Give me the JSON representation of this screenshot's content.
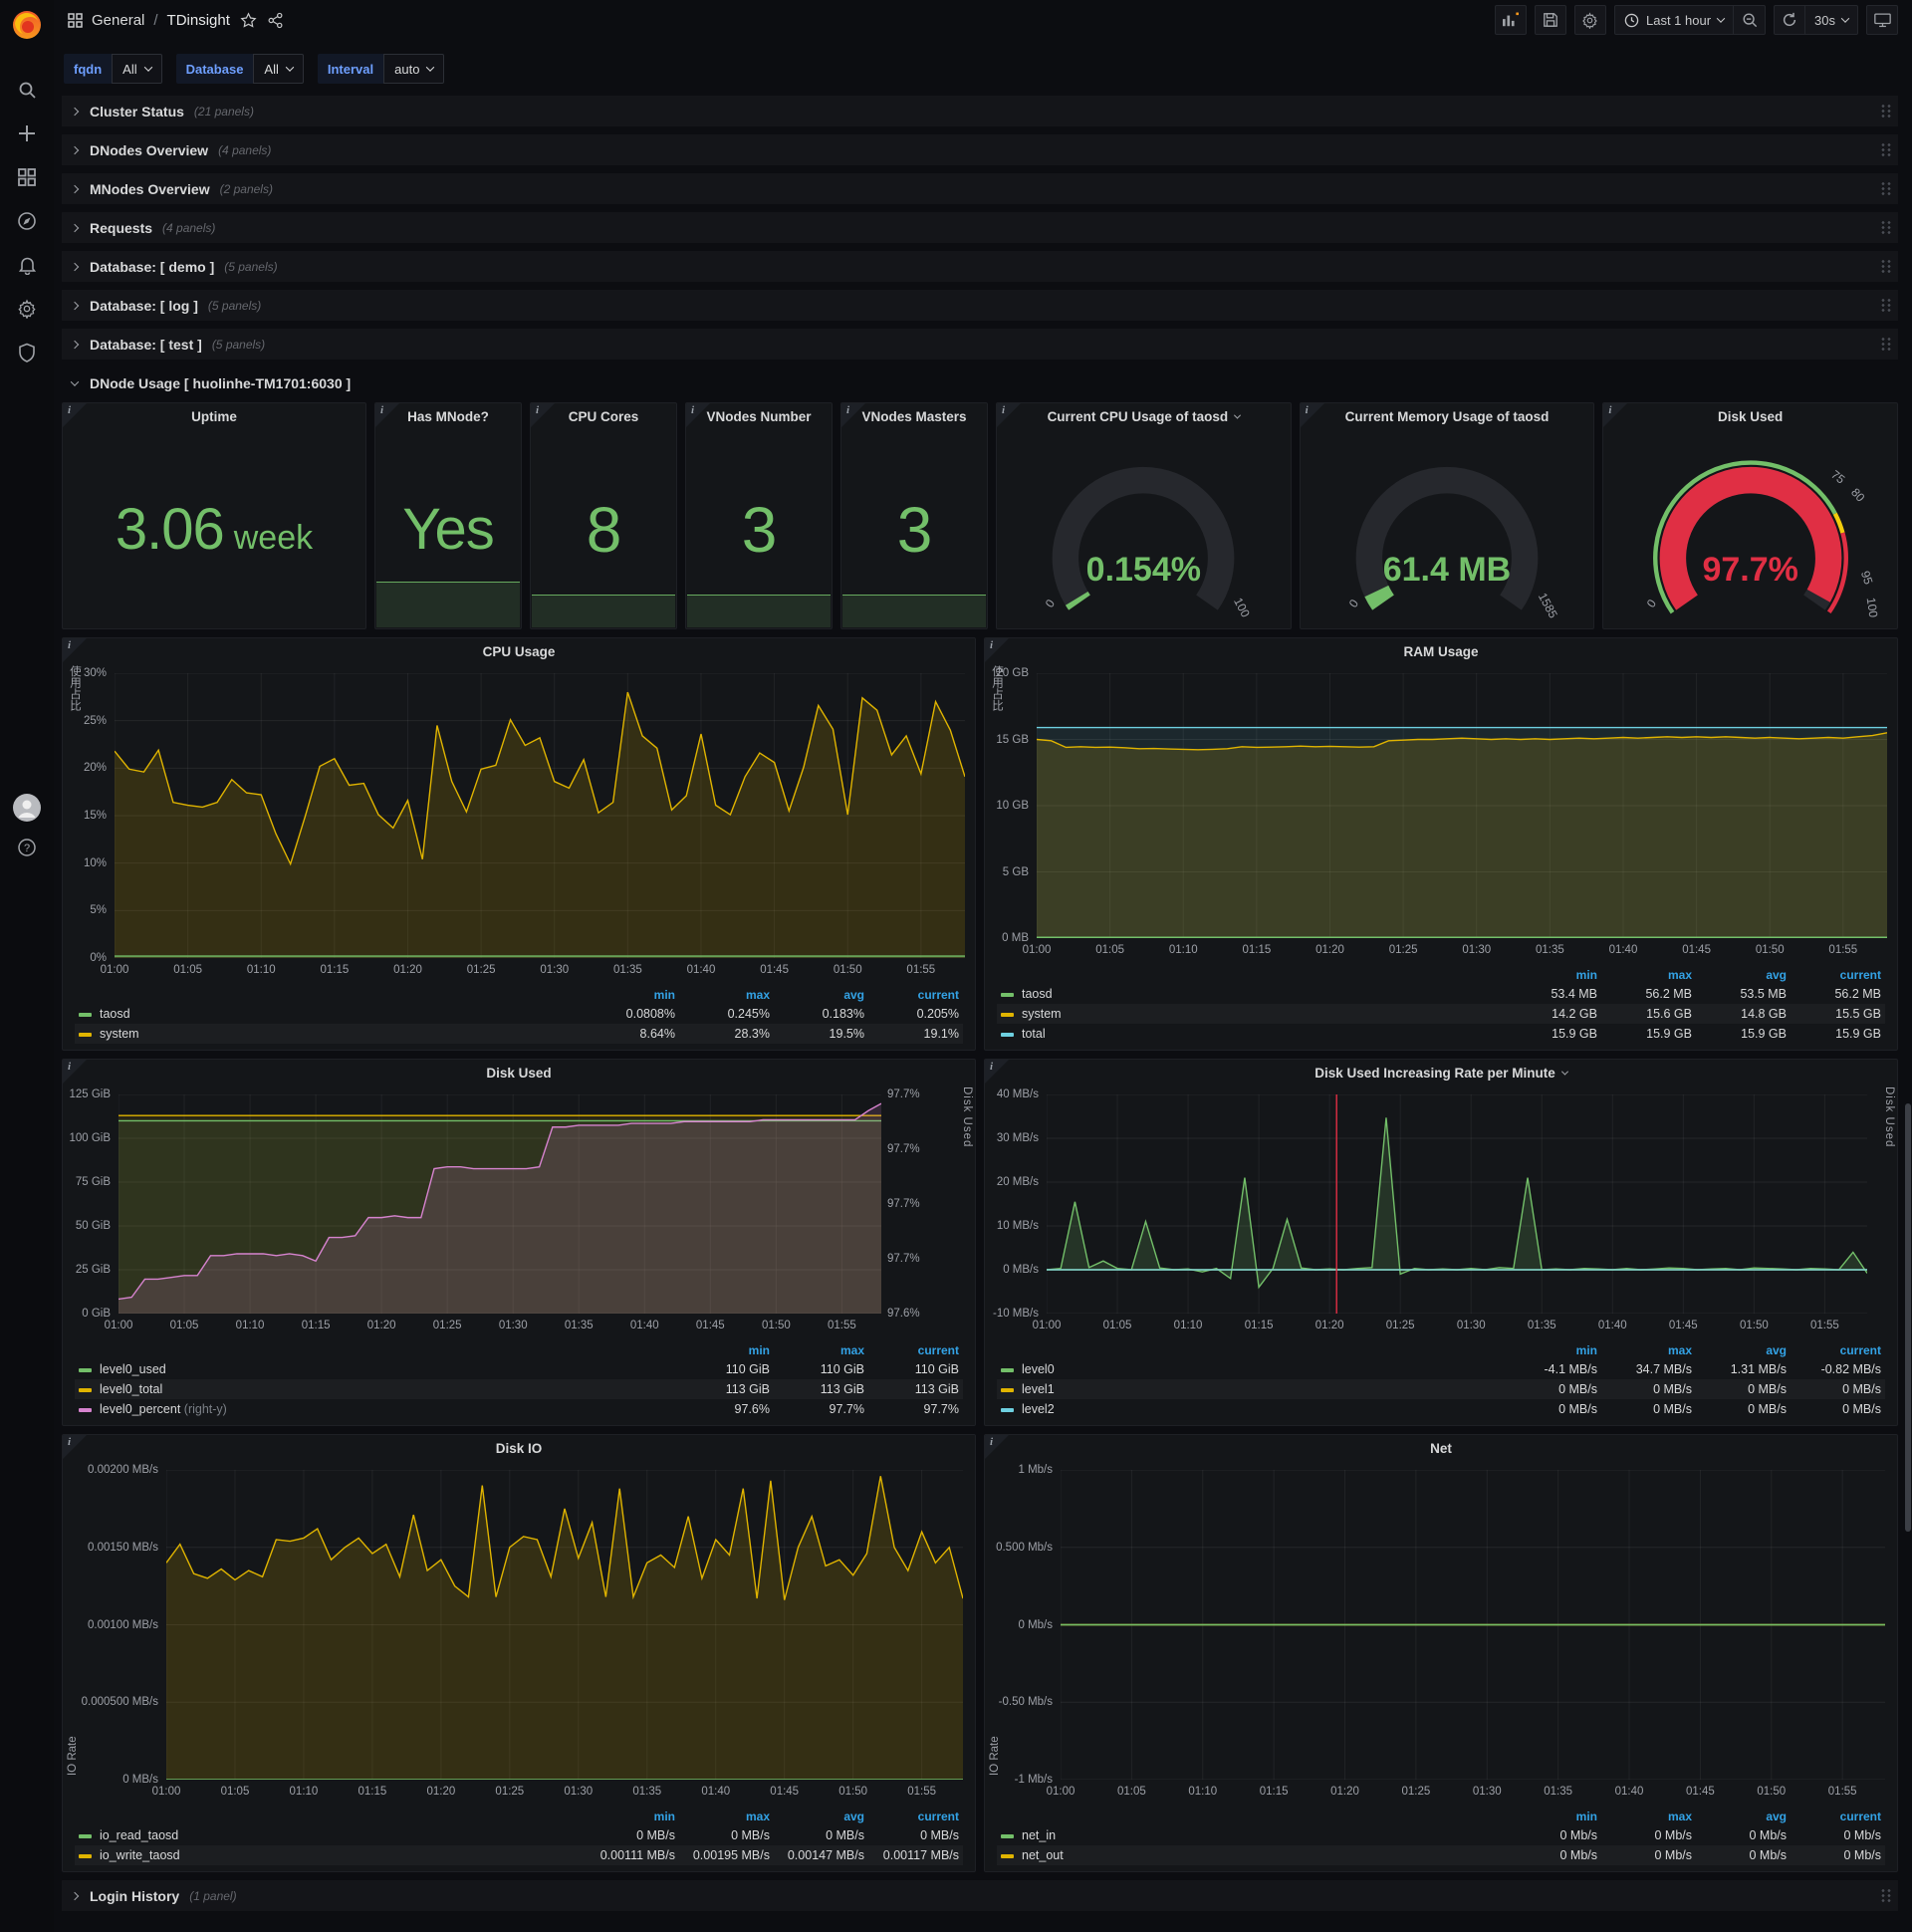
{
  "nav": {
    "section": "General",
    "separator": "/",
    "title": "TDinsight",
    "time_range": "Last 1 hour",
    "refresh_interval": "30s"
  },
  "variables": [
    {
      "label": "fqdn",
      "value": "All"
    },
    {
      "label": "Database",
      "value": "All"
    },
    {
      "label": "Interval",
      "value": "auto"
    }
  ],
  "rows": [
    {
      "title": "Cluster Status",
      "count": "(21 panels)"
    },
    {
      "title": "DNodes Overview",
      "count": "(4 panels)"
    },
    {
      "title": "MNodes Overview",
      "count": "(2 panels)"
    },
    {
      "title": "Requests",
      "count": "(4 panels)"
    },
    {
      "title": "Database: [ demo ]",
      "count": "(5 panels)"
    },
    {
      "title": "Database: [ log ]",
      "count": "(5 panels)"
    },
    {
      "title": "Database: [ test ]",
      "count": "(5 panels)"
    }
  ],
  "expanded_row": {
    "title": "DNode Usage [ huolinhe-TM1701:6030 ]"
  },
  "bottom_row": {
    "title": "Login History",
    "count": "(1 panel)"
  },
  "stats": [
    {
      "title": "Uptime",
      "value": "3.06",
      "unit": "week",
      "spark_h": 0
    },
    {
      "title": "Has MNode?",
      "value": "Yes",
      "spark_h": 46
    },
    {
      "title": "CPU Cores",
      "value": "8",
      "spark_h": 33
    },
    {
      "title": "VNodes Number",
      "value": "3",
      "spark_h": 33
    },
    {
      "title": "VNodes Masters",
      "value": "3",
      "spark_h": 33
    }
  ],
  "gauges": [
    {
      "title": "Current CPU Usage of taosd",
      "has_dropdown": true,
      "value": "0.154%",
      "percent": 1.5,
      "color": "#73bf69",
      "min_label": "0",
      "max_label": "100"
    },
    {
      "title": "Current Memory Usage of taosd",
      "has_dropdown": false,
      "value": "61.4 MB",
      "percent": 3.9,
      "color": "#73bf69",
      "min_label": "0",
      "max_label": "1585"
    },
    {
      "title": "Disk Used",
      "has_dropdown": false,
      "value": "97.7%",
      "percent": 97.7,
      "color": "#e02f44",
      "min_label": "0",
      "threshold_labels": {
        "t75": "75",
        "t80": "80",
        "t95": "95",
        "t100": "100"
      }
    }
  ],
  "charts": [
    {
      "title": "CPU Usage",
      "has_dropdown": false,
      "ylabel": "使用占比",
      "ylabel_cjk": true,
      "ylabel_right": null,
      "gutter_left": 52,
      "gutter_right": 10,
      "ylim": [
        0,
        30
      ],
      "yticks": [
        "30%",
        "25%",
        "20%",
        "15%",
        "10%",
        "5%",
        "0%"
      ],
      "xticks": [
        "01:00",
        "01:05",
        "01:10",
        "01:15",
        "01:20",
        "01:25",
        "01:30",
        "01:35",
        "01:40",
        "01:45",
        "01:50",
        "01:55"
      ],
      "x_count": 59,
      "series": [
        {
          "name": "system",
          "color": "#e0b400",
          "fill": "rgba(224,180,0,0.16)",
          "values": [
            21.8,
            19.9,
            19.6,
            21.9,
            16.4,
            16.1,
            15.9,
            16.4,
            18.8,
            17.4,
            17.2,
            13.1,
            9.9,
            14.9,
            20.2,
            21.0,
            18.2,
            18.4,
            15.1,
            13.7,
            16.6,
            10.4,
            24.5,
            18.6,
            15.4,
            19.9,
            20.3,
            25.1,
            22.4,
            23.2,
            18.6,
            17.9,
            20.9,
            15.3,
            16.4,
            28.0,
            23.4,
            22.1,
            15.6,
            17.1,
            23.6,
            16.1,
            15.1,
            19.1,
            21.6,
            20.6,
            15.5,
            20.1,
            26.6,
            24.1,
            15.1,
            27.4,
            26.1,
            21.4,
            23.4,
            19.4,
            27.0,
            24.0,
            19.1
          ]
        },
        {
          "name": "taosd",
          "color": "#73bf69",
          "fill": "rgba(115,191,105,0.12)",
          "flat": 0.2
        }
      ],
      "legend": {
        "columns": [
          "min",
          "max",
          "avg",
          "current"
        ],
        "rows": [
          {
            "name": "taosd",
            "color": "#73bf69",
            "values": [
              "0.0808%",
              "0.245%",
              "0.183%",
              "0.205%"
            ]
          },
          {
            "name": "system",
            "color": "#e0b400",
            "values": [
              "8.64%",
              "28.3%",
              "19.5%",
              "19.1%"
            ]
          }
        ]
      }
    },
    {
      "title": "RAM Usage",
      "has_dropdown": false,
      "ylabel": "使用占比",
      "ylabel_cjk": true,
      "ylabel_right": null,
      "gutter_left": 52,
      "gutter_right": 10,
      "ylim": [
        0,
        20
      ],
      "yticks": [
        "20 GB",
        "15 GB",
        "10 GB",
        "5 GB",
        "0 MB"
      ],
      "xticks": [
        "01:00",
        "01:05",
        "01:10",
        "01:15",
        "01:20",
        "01:25",
        "01:30",
        "01:35",
        "01:40",
        "01:45",
        "01:50",
        "01:55"
      ],
      "x_count": 59,
      "series": [
        {
          "name": "total",
          "color": "#6ed0e0",
          "fill": "rgba(110,208,224,0.10)",
          "flat": 15.9
        },
        {
          "name": "system",
          "color": "#e0b400",
          "fill": "rgba(224,180,0,0.16)",
          "values": [
            15.0,
            14.9,
            14.4,
            14.45,
            14.4,
            14.42,
            14.38,
            14.3,
            14.32,
            14.28,
            14.25,
            14.22,
            14.25,
            14.3,
            14.45,
            14.4,
            14.42,
            14.45,
            14.5,
            14.45,
            14.48,
            14.45,
            14.42,
            14.45,
            14.9,
            14.95,
            15.0,
            15.0,
            15.05,
            15.1,
            15.05,
            15.0,
            15.05,
            15.0,
            15.05,
            15.0,
            15.05,
            15.1,
            15.05,
            15.1,
            15.15,
            15.1,
            15.15,
            15.2,
            15.15,
            15.2,
            15.15,
            15.2,
            15.15,
            15.1,
            15.15,
            15.1,
            15.05,
            15.1,
            15.15,
            15.1,
            15.2,
            15.3,
            15.5
          ]
        },
        {
          "name": "taosd",
          "color": "#73bf69",
          "fill": "rgba(115,191,105,0.25)",
          "flat": 0.055
        }
      ],
      "legend": {
        "columns": [
          "min",
          "max",
          "avg",
          "current"
        ],
        "rows": [
          {
            "name": "taosd",
            "color": "#73bf69",
            "values": [
              "53.4 MB",
              "56.2 MB",
              "53.5 MB",
              "56.2 MB"
            ]
          },
          {
            "name": "system",
            "color": "#e0b400",
            "values": [
              "14.2 GB",
              "15.6 GB",
              "14.8 GB",
              "15.5 GB"
            ]
          },
          {
            "name": "total",
            "color": "#6ed0e0",
            "values": [
              "15.9 GB",
              "15.9 GB",
              "15.9 GB",
              "15.9 GB"
            ]
          }
        ]
      }
    },
    {
      "title": "Disk Used",
      "has_dropdown": false,
      "ylabel": null,
      "ylabel_cjk": false,
      "ylabel_right": "Disk Used",
      "gutter_left": 56,
      "gutter_right": 50,
      "ylim": [
        0,
        125
      ],
      "yticks": [
        "125 GiB",
        "100 GiB",
        "75 GiB",
        "50 GiB",
        "25 GiB",
        "0 GiB"
      ],
      "yticks_right": [
        "97.7%",
        "97.7%",
        "97.7%",
        "97.7%",
        "97.6%"
      ],
      "xticks": [
        "01:00",
        "01:05",
        "01:10",
        "01:15",
        "01:20",
        "01:25",
        "01:30",
        "01:35",
        "01:40",
        "01:45",
        "01:50",
        "01:55"
      ],
      "x_count": 59,
      "series": [
        {
          "name": "level0_total",
          "color": "#e0b400",
          "fill": "rgba(224,180,0,0.10)",
          "flat": 113
        },
        {
          "name": "level0_used",
          "color": "#73bf69",
          "fill": "rgba(115,191,105,0.10)",
          "flat": 110
        },
        {
          "name": "level0_percent",
          "color": "#d683ce",
          "fill": "rgba(214,131,206,0.16)",
          "ylim2": [
            97.592,
            97.713
          ],
          "values": [
            97.6,
            97.601,
            97.611,
            97.611,
            97.612,
            97.613,
            97.613,
            97.624,
            97.624,
            97.625,
            97.625,
            97.625,
            97.624,
            97.625,
            97.624,
            97.621,
            97.634,
            97.634,
            97.635,
            97.645,
            97.645,
            97.646,
            97.645,
            97.645,
            97.672,
            97.673,
            97.673,
            97.672,
            97.672,
            97.672,
            97.672,
            97.672,
            97.673,
            97.695,
            97.695,
            97.696,
            97.696,
            97.696,
            97.696,
            97.697,
            97.697,
            97.697,
            97.697,
            97.698,
            97.698,
            97.698,
            97.698,
            97.698,
            97.698,
            97.699,
            97.699,
            97.699,
            97.699,
            97.699,
            97.699,
            97.699,
            97.699,
            97.704,
            97.708
          ]
        }
      ],
      "legend": {
        "columns": [
          "min",
          "max",
          "current"
        ],
        "rows": [
          {
            "name": "level0_used",
            "color": "#73bf69",
            "values": [
              "110 GiB",
              "110 GiB",
              "110 GiB"
            ]
          },
          {
            "name": "level0_total",
            "color": "#e0b400",
            "values": [
              "113 GiB",
              "113 GiB",
              "113 GiB"
            ]
          },
          {
            "name": "level0_percent",
            "suffix": "(right-y)",
            "color": "#d683ce",
            "values": [
              "97.6%",
              "97.7%",
              "97.7%"
            ]
          }
        ]
      }
    },
    {
      "title": "Disk Used Increasing Rate per Minute",
      "has_dropdown": true,
      "ylabel": null,
      "ylabel_cjk": false,
      "ylabel_right": "Disk Used",
      "gutter_left": 62,
      "gutter_right": 14,
      "ylim": [
        -10,
        40
      ],
      "yticks": [
        "40 MB/s",
        "30 MB/s",
        "20 MB/s",
        "10 MB/s",
        "0 MB/s",
        "-10 MB/s"
      ],
      "xticks": [
        "01:00",
        "01:05",
        "01:10",
        "01:15",
        "01:20",
        "01:25",
        "01:30",
        "01:35",
        "01:40",
        "01:45",
        "01:50",
        "01:55"
      ],
      "x_count": 59,
      "annotation_frac": 0.3534,
      "annotation_color": "#e02f44",
      "series": [
        {
          "name": "level0",
          "color": "#73bf69",
          "fill": "rgba(115,191,105,0.18)",
          "values": [
            0,
            0.3,
            15.5,
            0.5,
            2,
            0.3,
            0,
            11,
            0.4,
            0,
            0.2,
            -0.5,
            0.3,
            -2,
            21,
            -4,
            0.3,
            11.5,
            0.4,
            0,
            0.2,
            0,
            0.3,
            0.5,
            34.7,
            -1,
            0.3,
            0,
            0.2,
            0,
            0.3,
            0,
            0.5,
            0.3,
            21,
            0,
            0.2,
            0,
            0.3,
            0.2,
            0,
            0.3,
            0,
            0.2,
            0.4,
            0.3,
            0,
            0.2,
            0.3,
            0,
            0.4,
            0.3,
            0.2,
            0,
            0.3,
            0.2,
            0,
            4,
            -0.8
          ]
        },
        {
          "name": "level1",
          "color": "#e0b400",
          "fill": "none",
          "flat": 0
        },
        {
          "name": "level2",
          "color": "#6ed0e0",
          "fill": "none",
          "flat": 0
        }
      ],
      "legend": {
        "columns": [
          "min",
          "max",
          "avg",
          "current"
        ],
        "rows": [
          {
            "name": "level0",
            "color": "#73bf69",
            "values": [
              "-4.1 MB/s",
              "34.7 MB/s",
              "1.31 MB/s",
              "-0.82 MB/s"
            ]
          },
          {
            "name": "level1",
            "color": "#e0b400",
            "values": [
              "0 MB/s",
              "0 MB/s",
              "0 MB/s",
              "0 MB/s"
            ]
          },
          {
            "name": "level2",
            "color": "#6ed0e0",
            "values": [
              "0 MB/s",
              "0 MB/s",
              "0 MB/s",
              "0 MB/s"
            ]
          }
        ]
      }
    },
    {
      "title": "Disk IO",
      "has_dropdown": false,
      "ylabel": "IO Rate",
      "ylabel_cjk": false,
      "ylabel_right": null,
      "gutter_left": 104,
      "gutter_right": 12,
      "ylim": [
        0,
        0.002
      ],
      "yticks": [
        "0.00200 MB/s",
        "0.00150 MB/s",
        "0.00100 MB/s",
        "0.000500 MB/s",
        "0 MB/s"
      ],
      "xticks": [
        "01:00",
        "01:05",
        "01:10",
        "01:15",
        "01:20",
        "01:25",
        "01:30",
        "01:35",
        "01:40",
        "01:45",
        "01:50",
        "01:55"
      ],
      "x_count": 59,
      "series": [
        {
          "name": "io_write_taosd",
          "color": "#e0b400",
          "fill": "rgba(224,180,0,0.16)",
          "values": [
            0.0014,
            0.00152,
            0.00133,
            0.0013,
            0.00136,
            0.00129,
            0.00135,
            0.00131,
            0.00155,
            0.00154,
            0.00156,
            0.00162,
            0.00142,
            0.0015,
            0.00156,
            0.00146,
            0.00152,
            0.00131,
            0.00171,
            0.00135,
            0.00142,
            0.00125,
            0.00118,
            0.0019,
            0.00118,
            0.0015,
            0.00157,
            0.00155,
            0.00131,
            0.00175,
            0.00143,
            0.00166,
            0.00118,
            0.00188,
            0.00118,
            0.0014,
            0.00145,
            0.00137,
            0.0017,
            0.0013,
            0.00155,
            0.00145,
            0.00188,
            0.00117,
            0.00193,
            0.00116,
            0.0015,
            0.0017,
            0.00138,
            0.00142,
            0.00132,
            0.00146,
            0.00196,
            0.0015,
            0.00135,
            0.0016,
            0.0014,
            0.0015,
            0.00117
          ]
        },
        {
          "name": "io_read_taosd",
          "color": "#73bf69",
          "fill": "none",
          "flat": 0
        }
      ],
      "legend": {
        "columns": [
          "min",
          "max",
          "avg",
          "current"
        ],
        "rows": [
          {
            "name": "io_read_taosd",
            "color": "#73bf69",
            "values": [
              "0 MB/s",
              "0 MB/s",
              "0 MB/s",
              "0 MB/s"
            ]
          },
          {
            "name": "io_write_taosd",
            "color": "#e0b400",
            "values": [
              "0.00111 MB/s",
              "0.00195 MB/s",
              "0.00147 MB/s",
              "0.00117 MB/s"
            ]
          }
        ]
      }
    },
    {
      "title": "Net",
      "has_dropdown": false,
      "ylabel": "IO Rate",
      "ylabel_cjk": false,
      "ylabel_right": null,
      "gutter_left": 76,
      "gutter_right": 12,
      "ylim": [
        -1,
        1
      ],
      "yticks": [
        "1 Mb/s",
        "0.500 Mb/s",
        "0 Mb/s",
        "-0.50 Mb/s",
        "-1 Mb/s"
      ],
      "xticks": [
        "01:00",
        "01:05",
        "01:10",
        "01:15",
        "01:20",
        "01:25",
        "01:30",
        "01:35",
        "01:40",
        "01:45",
        "01:50",
        "01:55"
      ],
      "x_count": 59,
      "series": [
        {
          "name": "net_out",
          "color": "#e0b400",
          "fill": "none",
          "flat": 0
        },
        {
          "name": "net_in",
          "color": "#73bf69",
          "fill": "none",
          "flat": 0
        }
      ],
      "legend": {
        "columns": [
          "min",
          "max",
          "avg",
          "current"
        ],
        "rows": [
          {
            "name": "net_in",
            "color": "#73bf69",
            "values": [
              "0 Mb/s",
              "0 Mb/s",
              "0 Mb/s",
              "0 Mb/s"
            ]
          },
          {
            "name": "net_out",
            "color": "#e0b400",
            "values": [
              "0 Mb/s",
              "0 Mb/s",
              "0 Mb/s",
              "0 Mb/s"
            ]
          }
        ]
      }
    }
  ]
}
